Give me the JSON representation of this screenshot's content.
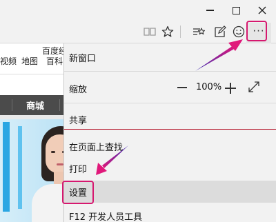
{
  "page": {
    "nav_items": [
      "视频",
      "地图",
      "百科"
    ],
    "top_link": "百度经",
    "dark_nav_item": "商城"
  },
  "browser": {
    "more_label": "···"
  },
  "menu": {
    "new_window": "新窗口",
    "zoom_label": "缩放",
    "zoom_value": "100%",
    "share": "共享",
    "find_on_page": "在页面上查找",
    "print": "打印",
    "settings": "设置",
    "f12": "F12 开发人员工具"
  },
  "colors": {
    "highlight_border": "#d6186f",
    "menu_background": "#f2f2f2",
    "hover_row": "#dcdcdc",
    "separator_accent": "#b4152b"
  },
  "icons": [
    "minimize-icon",
    "maximize-icon",
    "close-icon",
    "reading-view-icon",
    "favorite-star-icon",
    "hub-icon",
    "web-note-icon",
    "feedback-smiley-icon",
    "more-icon",
    "zoom-out-icon",
    "zoom-in-icon",
    "fullscreen-icon"
  ]
}
